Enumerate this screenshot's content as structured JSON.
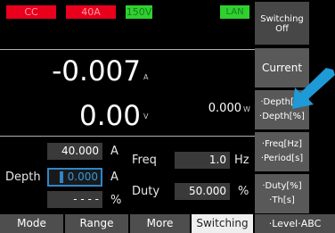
{
  "status": {
    "mode": "CC",
    "range_current": "40A",
    "range_voltage": "150V",
    "interface": "LAN"
  },
  "measure": {
    "current_value": "-0.007",
    "current_unit": "A",
    "voltage_value": "0.00",
    "voltage_unit": "V",
    "power_value": "0.000",
    "power_unit": "W"
  },
  "settings": {
    "level_value": "40.000",
    "level_unit": "A",
    "depth_label": "Depth",
    "depth_value": "0.000",
    "depth_unit": "A",
    "percent_value": "- - - -",
    "percent_unit": "%",
    "freq_label": "Freq",
    "freq_value": "1.0",
    "freq_unit": "Hz",
    "duty_label": "Duty",
    "duty_value": "50.000",
    "duty_unit": "%"
  },
  "softkeys": {
    "switching_line1": "Switching",
    "switching_line2": "Off",
    "current": "Current",
    "depth_a": "·Depth[A]",
    "depth_pct": "·Depth[%]",
    "freq_hz": "·Freq[Hz]",
    "period_s": "·Period[s]",
    "duty_pct": "·Duty[%]",
    "th_s": "·Th[s]"
  },
  "tabs": {
    "mode": "Mode",
    "range": "Range",
    "more": "More",
    "switching": "Switching",
    "level_abc": "·Level·ABC"
  },
  "colors": {
    "status_red": "#e8001c",
    "status_green": "#2fd12f",
    "focus_blue": "#2f86c8",
    "arrow_blue": "#1e9ad6"
  }
}
